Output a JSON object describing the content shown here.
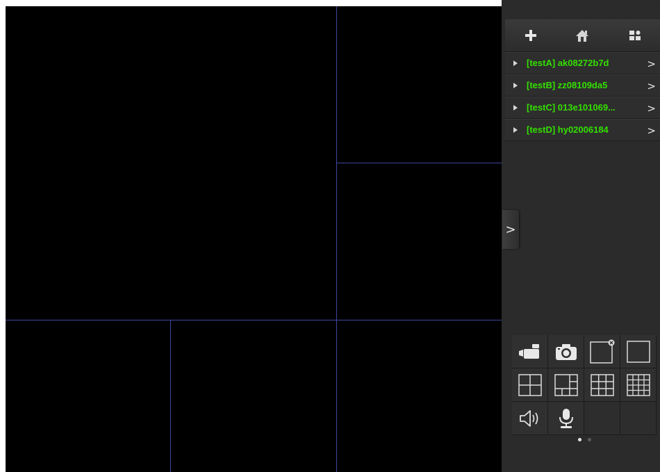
{
  "toolbar": {
    "add_icon": "plus-icon",
    "home_icon": "home-icon",
    "settings_icon": "panel-settings-icon"
  },
  "devices": [
    {
      "label": "[testA] ak08272b7d"
    },
    {
      "label": "[testB] zz08109da5"
    },
    {
      "label": "[testC] 013e101069..."
    },
    {
      "label": "[testD] hy02006184"
    }
  ],
  "colors": {
    "device_label": "#33e000",
    "pane_divider": "#3f46a0",
    "panel_bg": "#2a2a2a"
  },
  "controls": [
    {
      "name": "record-video",
      "icon": "video-camera-icon"
    },
    {
      "name": "snapshot",
      "icon": "camera-icon"
    },
    {
      "name": "close-view",
      "icon": "close-view-icon"
    },
    {
      "name": "layout-1",
      "icon": "layout-1-icon"
    },
    {
      "name": "layout-4",
      "icon": "layout-4-icon"
    },
    {
      "name": "layout-6",
      "icon": "layout-6-icon"
    },
    {
      "name": "layout-9",
      "icon": "layout-9-icon"
    },
    {
      "name": "layout-16",
      "icon": "layout-16-icon"
    },
    {
      "name": "audio",
      "icon": "speaker-icon"
    },
    {
      "name": "talk",
      "icon": "microphone-icon"
    }
  ],
  "pagination": {
    "current": 1,
    "total": 2
  }
}
